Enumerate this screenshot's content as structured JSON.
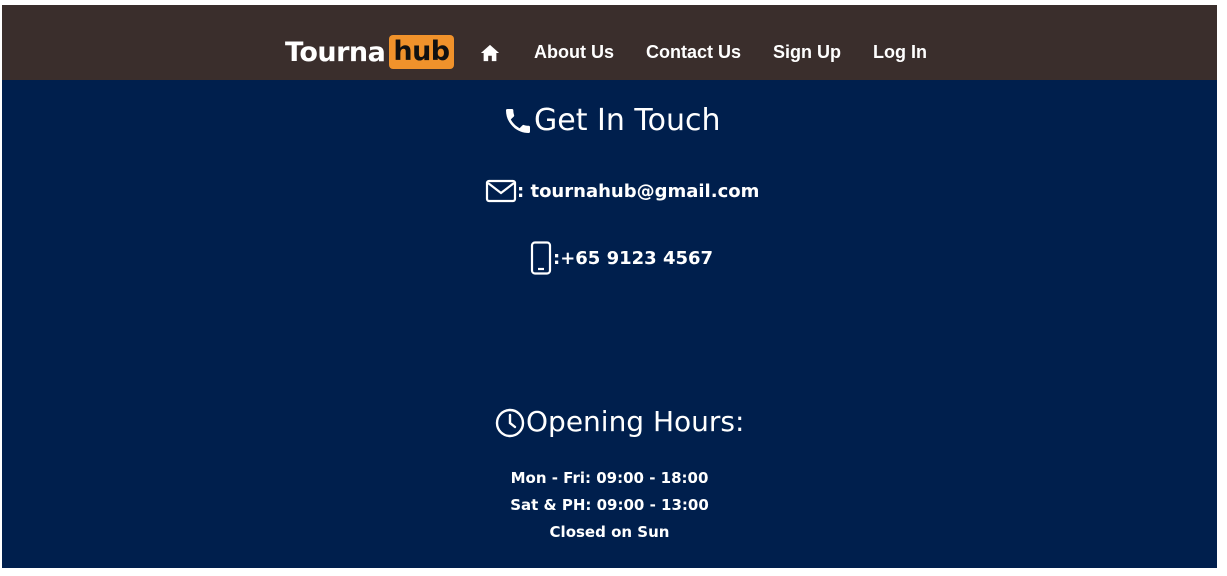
{
  "nav": {
    "logo_left": "Tourna",
    "logo_right": "hub",
    "home_icon": "home-icon",
    "links": [
      "About Us",
      "Contact Us",
      "Sign Up",
      "Log In"
    ]
  },
  "contact": {
    "heading": "Get In Touch",
    "heading_icon": "phone-icon",
    "email_icon": "mail-icon",
    "email_text": ": tournahub@gmail.com",
    "phone_icon": "mobile-icon",
    "phone_text": ":+65 9123 4567"
  },
  "hours": {
    "heading": "Opening Hours:",
    "heading_icon": "clock-icon",
    "lines": [
      "Mon - Fri: 09:00 - 18:00",
      "Sat & PH: 09:00 - 13:00",
      "Closed on Sun"
    ]
  },
  "colors": {
    "navbar": "#3a2e2c",
    "background": "#001f4d",
    "logo_accent": "#f0922b"
  }
}
